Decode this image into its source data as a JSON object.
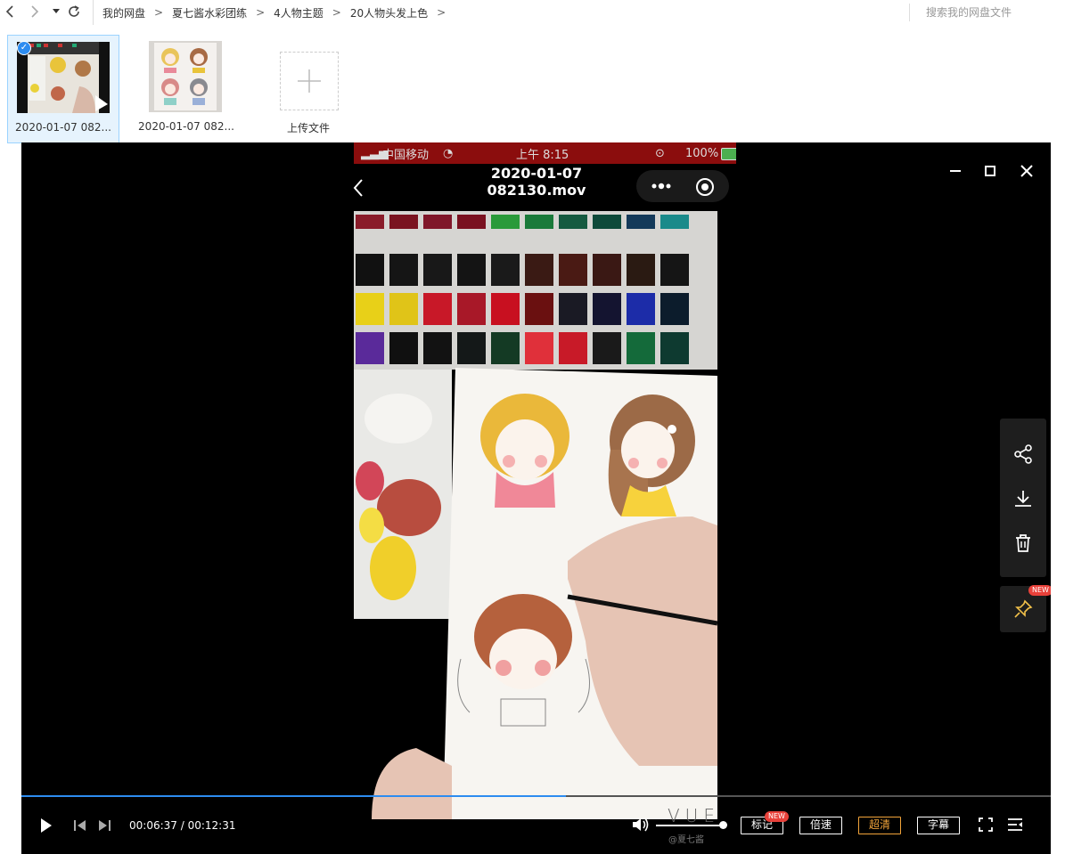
{
  "nav": {
    "breadcrumbs": [
      "我的网盘",
      "夏七酱水彩团练",
      "4人物主题",
      "20人物头发上色"
    ],
    "separator": ">",
    "search_placeholder": "搜索我的网盘文件"
  },
  "files": [
    {
      "name": "2020-01-07 082...",
      "selected": true,
      "type": "video"
    },
    {
      "name": "2020-01-07 082...",
      "selected": false,
      "type": "image"
    }
  ],
  "upload": {
    "label": "上传文件"
  },
  "player": {
    "title": "2020-01-07 082130.mov",
    "status_bar": {
      "carrier": "中国移动",
      "time": "上午 8:15",
      "battery": "100%"
    },
    "current_time": "00:06:37",
    "total_time": "00:12:31",
    "progress": 0.529,
    "volume": 1.0,
    "buttons": {
      "mark": "标记",
      "speed": "倍速",
      "quality": "超清",
      "subtitle": "字幕"
    },
    "new_badge": "NEW",
    "watermark": "VUE",
    "watermark_sub": "@夏七酱"
  },
  "colors": {
    "accent": "#2d8cf0",
    "selected_bg": "#e6f3fd",
    "quality_highlight": "#f2a43a",
    "badge": "#e8413a"
  }
}
